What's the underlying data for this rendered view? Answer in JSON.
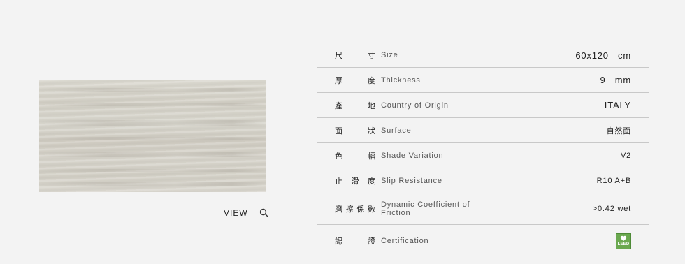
{
  "view": {
    "label": "VIEW"
  },
  "specs": [
    {
      "zh": [
        "尺",
        "寸"
      ],
      "en": "Size",
      "value": "60x120   cm"
    },
    {
      "zh": [
        "厚",
        "度"
      ],
      "en": "Thickness",
      "value": "9   mm"
    },
    {
      "zh": [
        "產",
        "地"
      ],
      "en": "Country of Origin",
      "value": "ITALY"
    },
    {
      "zh": [
        "面",
        "狀"
      ],
      "en": "Surface",
      "value": "自然面"
    },
    {
      "zh": [
        "色",
        "幅"
      ],
      "en": "Shade Variation",
      "value": "V2"
    },
    {
      "zh": [
        "止",
        "滑",
        "度"
      ],
      "en": "Slip Resistance",
      "value": "R10 A+B"
    },
    {
      "zh": [
        "磨",
        "擦",
        "係",
        "數"
      ],
      "en_line1": "Dynamic Coefficient of",
      "en_line2": "Friction",
      "value": ">0.42 wet"
    },
    {
      "zh": [
        "認",
        "證"
      ],
      "en": "Certification",
      "badge": "LEED"
    }
  ],
  "colors": {
    "background": "#f3f3f3",
    "divider": "#c8c8c8",
    "leed_green": "#6aa84f"
  },
  "icons": {
    "search": "search-icon",
    "leed": "leed-badge-icon"
  }
}
